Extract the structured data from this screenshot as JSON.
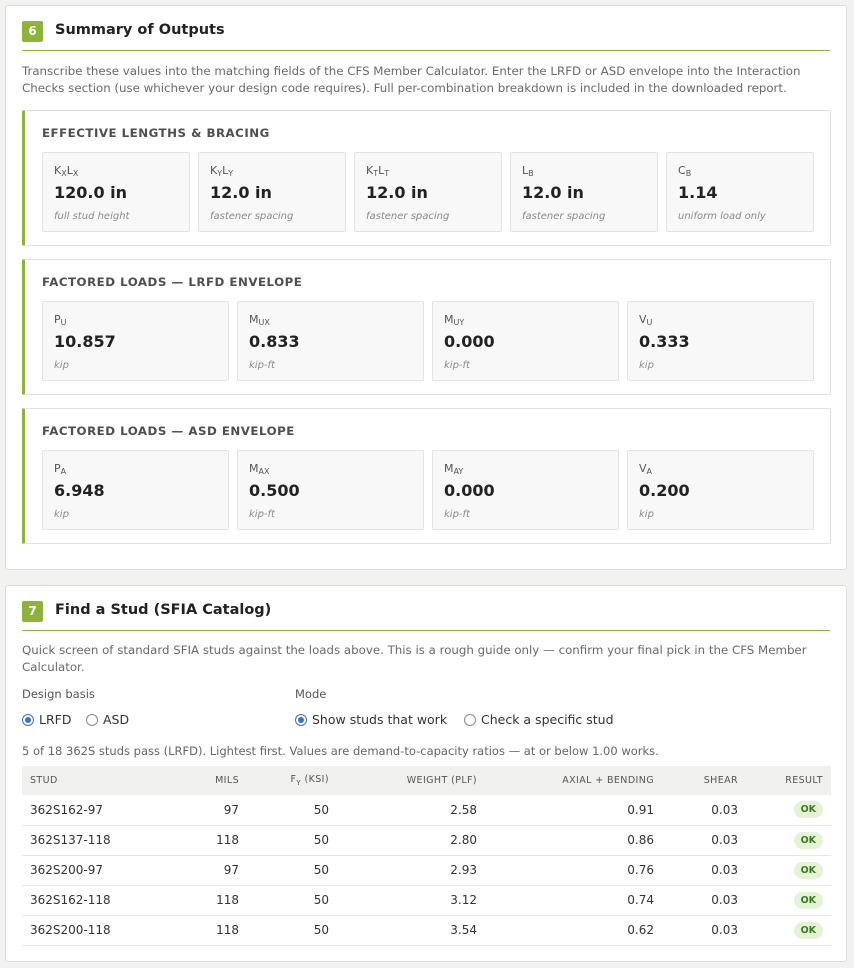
{
  "summary_outputs": {
    "number": "6",
    "title": "Summary of Outputs",
    "description": "Transcribe these values into the matching fields of the CFS Member Calculator. Enter the LRFD or ASD envelope into the Interaction Checks section (use whichever your design code requires). Full per-combination breakdown is included in the downloaded report.",
    "effective_lengths": {
      "title": "EFFECTIVE LENGTHS & BRACING",
      "items": [
        {
          "label_main": "K",
          "label_sub": "X",
          "label_main2": "L",
          "label_sub2": "X",
          "value": "120.0 in",
          "unit": "full stud height"
        },
        {
          "label_main": "K",
          "label_sub": "Y",
          "label_main2": "L",
          "label_sub2": "Y",
          "value": "12.0 in",
          "unit": "fastener spacing"
        },
        {
          "label_main": "K",
          "label_sub": "T",
          "label_main2": "L",
          "label_sub2": "T",
          "value": "12.0 in",
          "unit": "fastener spacing"
        },
        {
          "label_main": "L",
          "label_sub": "B",
          "value": "12.0 in",
          "unit": "fastener spacing"
        },
        {
          "label_main": "C",
          "label_sub": "B",
          "value": "1.14",
          "unit": "uniform load only"
        }
      ]
    },
    "lrfd": {
      "title": "FACTORED LOADS — LRFD ENVELOPE",
      "items": [
        {
          "label_main": "P",
          "label_sub": "U",
          "value": "10.857",
          "unit": "kip"
        },
        {
          "label_main": "M",
          "label_sub": "UX",
          "value": "0.833",
          "unit": "kip-ft"
        },
        {
          "label_main": "M",
          "label_sub": "UY",
          "value": "0.000",
          "unit": "kip-ft"
        },
        {
          "label_main": "V",
          "label_sub": "U",
          "value": "0.333",
          "unit": "kip"
        }
      ]
    },
    "asd": {
      "title": "FACTORED LOADS — ASD ENVELOPE",
      "items": [
        {
          "label_main": "P",
          "label_sub": "A",
          "value": "6.948",
          "unit": "kip"
        },
        {
          "label_main": "M",
          "label_sub": "AX",
          "value": "0.500",
          "unit": "kip-ft"
        },
        {
          "label_main": "M",
          "label_sub": "AY",
          "value": "0.000",
          "unit": "kip-ft"
        },
        {
          "label_main": "V",
          "label_sub": "A",
          "value": "0.200",
          "unit": "kip"
        }
      ]
    }
  },
  "find_stud": {
    "number": "7",
    "title": "Find a Stud (SFIA Catalog)",
    "description": "Quick screen of standard SFIA studs against the loads above. This is a rough guide only — confirm your final pick in the CFS Member Calculator.",
    "design_basis": {
      "label": "Design basis",
      "options": [
        "LRFD",
        "ASD"
      ],
      "selected": "LRFD"
    },
    "mode": {
      "label": "Mode",
      "options": [
        "Show studs that work",
        "Check a specific stud"
      ],
      "selected": "Show studs that work"
    },
    "summary": "5 of 18 362S studs pass (LRFD). Lightest first. Values are demand-to-capacity ratios — at or below 1.00 works.",
    "table": {
      "headers": {
        "stud": "STUD",
        "mils": "MILS",
        "fy_main": "F",
        "fy_sub": "Y",
        "fy_rest": " (KSI)",
        "weight": "WEIGHT (PLF)",
        "axial": "AXIAL + BENDING",
        "shear": "SHEAR",
        "result": "RESULT"
      },
      "rows": [
        {
          "stud": "362S162-97",
          "mils": "97",
          "fy": "50",
          "weight": "2.58",
          "axial": "0.91",
          "shear": "0.03",
          "result": "OK"
        },
        {
          "stud": "362S137-118",
          "mils": "118",
          "fy": "50",
          "weight": "2.80",
          "axial": "0.86",
          "shear": "0.03",
          "result": "OK"
        },
        {
          "stud": "362S200-97",
          "mils": "97",
          "fy": "50",
          "weight": "2.93",
          "axial": "0.76",
          "shear": "0.03",
          "result": "OK"
        },
        {
          "stud": "362S162-118",
          "mils": "118",
          "fy": "50",
          "weight": "3.12",
          "axial": "0.74",
          "shear": "0.03",
          "result": "OK"
        },
        {
          "stud": "362S200-118",
          "mils": "118",
          "fy": "50",
          "weight": "3.54",
          "axial": "0.62",
          "shear": "0.03",
          "result": "OK"
        }
      ]
    }
  },
  "colors": {
    "accent": "#8db33a",
    "radio_selected": "#3a6fd8",
    "ok_badge_bg": "#e6f2d6",
    "ok_badge_text": "#3a7a20"
  }
}
